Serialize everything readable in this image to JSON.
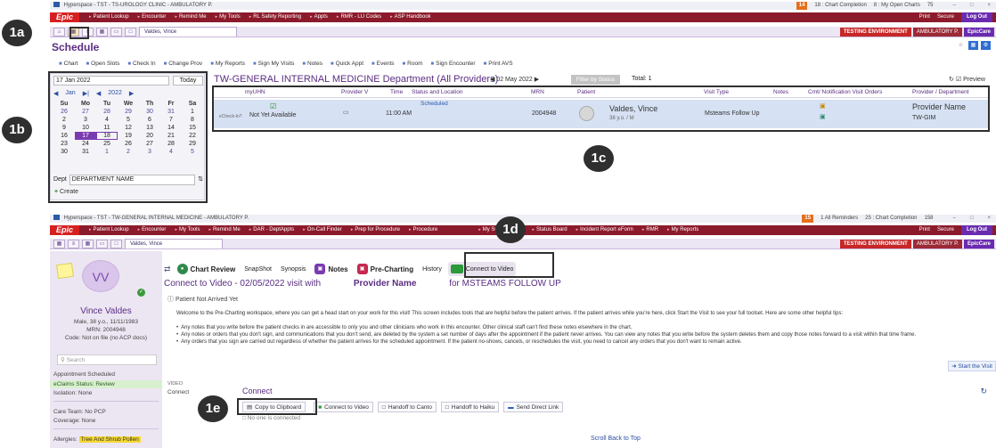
{
  "callouts": {
    "a": "1a",
    "b": "1b",
    "c": "1c",
    "d": "1d",
    "e": "1e"
  },
  "top": {
    "titlebar": "Hyperspace - TST - TS-UROLOGY CLINIC - AMBULATORY P.",
    "badge_count": "14",
    "chart_completion": "18 : Chart Completion",
    "open_charts": "8 : My Open Charts",
    "count_75": "75",
    "menu": [
      "Patient Lookup",
      "Encounter",
      "Remind Me",
      "My Tools",
      "RL Safety Reporting",
      "Appts",
      "RMR - LU Codes",
      "ASP Handbook"
    ],
    "menu_right": [
      "Print",
      "Secure",
      "Log Out"
    ],
    "tab_label": "Valdes, Vince",
    "env_testing": "TESTING ENVIRONMENT",
    "env_amb": "AMBULATORY P.",
    "env_epiccare": "EpicCare",
    "schedule_title": "Schedule",
    "schedule_toolbar": [
      "Chart",
      "Open Slots",
      "Check In",
      "Change Prov",
      "My Reports",
      "Sign My Visits",
      "Notes",
      "Quick Appt",
      "Events",
      "Room",
      "Sign Encounter",
      "Print AVS"
    ],
    "calendar": {
      "date_value": "17 Jan 2022",
      "today_label": "Today",
      "month": "Jan",
      "year": "2022",
      "weekdays": [
        "Su",
        "Mo",
        "Tu",
        "We",
        "Th",
        "Fr",
        "Sa"
      ],
      "days": [
        "26",
        "27",
        "28",
        "29",
        "30",
        "31",
        "1",
        "2",
        "3",
        "4",
        "5",
        "6",
        "7",
        "8",
        "9",
        "10",
        "11",
        "12",
        "13",
        "14",
        "15",
        "16",
        "17",
        "18",
        "19",
        "20",
        "21",
        "22",
        "23",
        "24",
        "25",
        "26",
        "27",
        "28",
        "29",
        "30",
        "31",
        "1",
        "2",
        "3",
        "4",
        "5"
      ],
      "dept_label": "Dept",
      "dept_value": "DEPARTMENT NAME",
      "create_label": "Create"
    },
    "dept_title": "TW-GENERAL INTERNAL MEDICINE Department (All Providers)",
    "date_nav": "02 May 2022",
    "filter_btn": "Filter by Status",
    "total": "Total: 1",
    "preview": "Preview",
    "columns": [
      "myUHN",
      "Provider V",
      "Time",
      "Status and Location",
      "MRN",
      "Patient",
      "Visit Type",
      "Notes",
      "Cmt/ Notification Visit Orders",
      "Provider / Department"
    ],
    "appointment": {
      "echeckin": "eCheck-In?",
      "myuhn": "Not Yet Available",
      "time": "11:00 AM",
      "status": "Scheduled",
      "mrn": "2004948",
      "patient_name": "Valdes, Vince",
      "patient_sub": "38 y.o. / M",
      "visit_type": "Msteams Follow Up",
      "provider": "Provider Name",
      "department": "TW-GIM"
    }
  },
  "bottom": {
    "titlebar": "Hyperspace - TST - TW-GENERAL INTERNAL MEDICINE - AMBULATORY P.",
    "badge_count": "15",
    "reminders": "1 All Reminders",
    "chart_completion": "25 : Chart Completion",
    "count_158": "158",
    "menu": [
      "Patient Lookup",
      "Encounter",
      "My Tools",
      "Remind Me",
      "DAR - DeptAppts",
      "On-Call Finder",
      "Prep for Procedure",
      "Procedure",
      "My Subscriptions",
      "Status Board",
      "Incident Report eForm",
      "RMR",
      "My Reports"
    ],
    "menu_right": [
      "Print",
      "Secure",
      "Log Out"
    ],
    "tab_label": "Valdes, Vince",
    "env_testing": "TESTING ENVIRONMENT",
    "env_amb": "AMBULATORY P.",
    "env_epiccare": "EpicCare",
    "patient": {
      "initials": "VV",
      "name": "Vince Valdes",
      "demo": "Male, 38 y.o., 11/11/1983",
      "mrn": "MRN: 2004948",
      "code": "Code: Not on file (no ACP docs)",
      "search": "Search",
      "appt": "Appointment Scheduled",
      "claims": "eClaims Status: Review",
      "isolation": "Isolation: None",
      "care_team": "Care Team: No PCP",
      "coverage": "Coverage: None",
      "allergies_label": "Allergies:",
      "allergies_value": "Tree And Shrub Pollen"
    },
    "nav": [
      "Chart Review",
      "SnapShot",
      "Synopsis",
      "Notes",
      "Pre-Charting",
      "History",
      "Connect to Video"
    ],
    "ctv_title_prefix": "Connect to Video - 02/05/2022 visit with",
    "ctv_provider": "Provider Name",
    "ctv_title_suffix": "for MSTEAMS FOLLOW UP",
    "not_arrived": "Patient Not Arrived Yet",
    "welcome": "Welcome to the Pre-Charting workspace, where you can get a head start on your work for this visit! This screen includes tools that are helpful before the patient arrives. If the patient arrives while you're here, click Start the Visit to see your full toolset. Here are some other helpful tips:",
    "bullets": [
      "Any notes that you write before the patient checks in are accessible to only you and other clinicians who work in this encounter. Other clinical staff can't find these notes elsewhere in the chart.",
      "Any notes or orders that you don't sign, and communications that you don't send, are deleted by the system a set number of days after the appointment if the patient never arrives. You can view any notes that you write before the system deletes them and copy those notes forward to a visit within that time frame.",
      "Any orders that you sign are carried out regardless of whether the patient arrives for the scheduled appointment. If the patient no-shows, cancels, or reschedules the visit, you need to cancel any orders that you don't want to remain active."
    ],
    "start_visit": "Start the Visit",
    "video_label": "VIDEO",
    "connect_side": "Connect",
    "connect_title": "Connect",
    "buttons": [
      "Copy to Clipboard",
      "Connect to Video",
      "Handoff to Canto",
      "Handoff to Haiku",
      "Send Direct Link"
    ],
    "no_one": "No one is connected",
    "scroll_back": "Scroll Back to Top"
  }
}
